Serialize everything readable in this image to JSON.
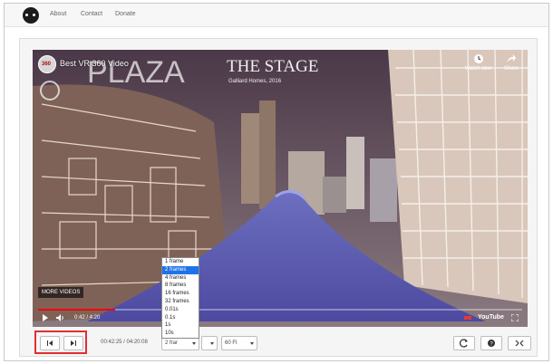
{
  "nav": {
    "links": [
      "About",
      "Contact",
      "Donate"
    ]
  },
  "video": {
    "title": "Best VR 360 Video",
    "channel_badge": "360",
    "watch_later_label": "Watch later",
    "share_label": "Share",
    "more_videos_label": "MORE VIDEOS",
    "time_display": "0:42 / 4:20",
    "progress": 0.16,
    "scene_text": {
      "plaza": "PLAZA",
      "stage": "THE STAGE",
      "developer": "Galliard Homes, 2016"
    },
    "youtube_label": "YouTube"
  },
  "controls": {
    "time_field": "00:42:25 / 04:20:08",
    "step_select": "2 frar",
    "fps_select": "60 FI",
    "icons": [
      "step-back-icon",
      "step-forward-icon",
      "refresh-icon",
      "help-icon",
      "fullscreen-icon"
    ]
  },
  "step_options": [
    "1 frame",
    "2 frames",
    "4 frames",
    "8 frames",
    "16 frames",
    "32 frames",
    "0.01s",
    "0.1s",
    "1s",
    "10s"
  ],
  "selected_step": "2 frames",
  "colors": {
    "accent_red": "#e03030",
    "selection_blue": "#1e73e8",
    "progress_red": "#ff0000"
  }
}
